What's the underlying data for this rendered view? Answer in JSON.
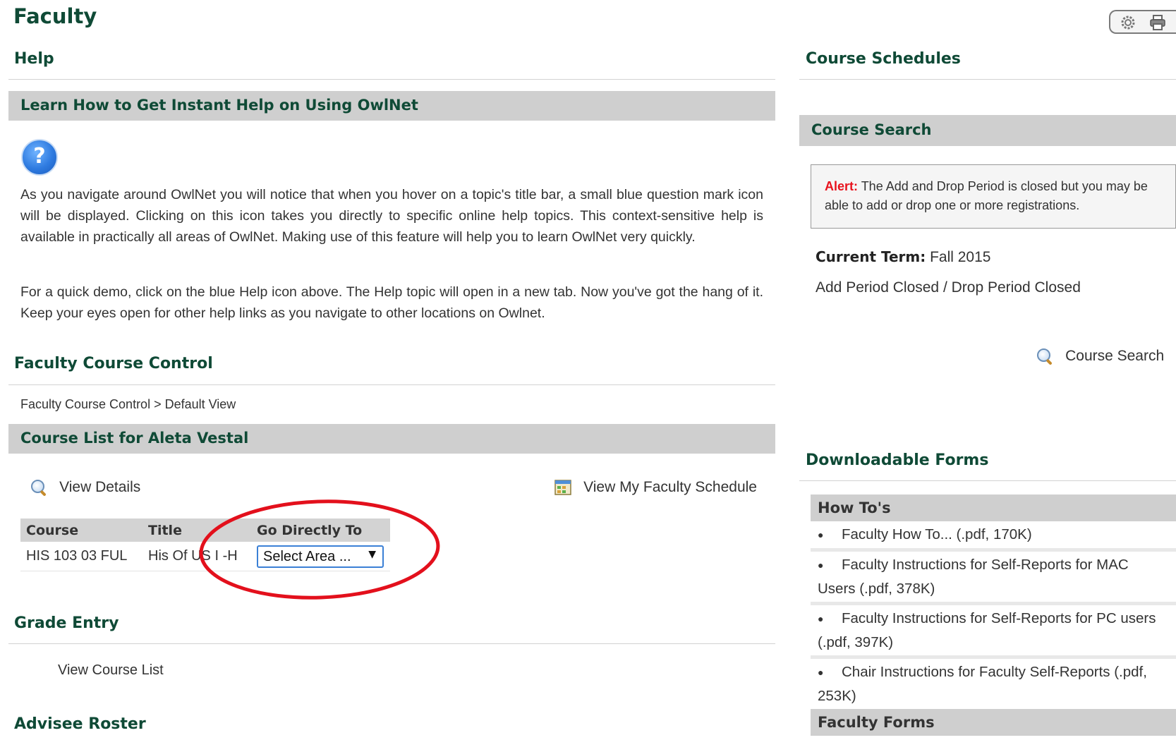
{
  "page": {
    "title": "Faculty"
  },
  "toolbar": {
    "settings_icon": "gear-icon",
    "print_icon": "printer-icon"
  },
  "help": {
    "section_title": "Help",
    "bar_title": "Learn How to Get Instant Help on Using OwlNet",
    "icon": "help-question-icon",
    "icon_glyph": "?",
    "paragraph1": "As you navigate around OwlNet you will notice that when you hover on a topic's title bar, a small blue question mark icon will be displayed. Clicking on this icon takes you directly to specific online help topics. This context-sensitive help is available in practically all areas of OwlNet. Making use of this feature will help you to learn OwlNet very quickly.",
    "paragraph2": "For a quick demo, click on the blue Help icon above. The Help topic will open in a new tab. Now you've got the hang of it. Keep your eyes open for other help links as you navigate to other locations on Owlnet."
  },
  "fcc": {
    "section_title": "Faculty Course Control",
    "breadcrumb": "Faculty Course Control > Default View",
    "course_list_title": "Course List for Aleta Vestal",
    "view_details": "View Details",
    "view_schedule": "View My Faculty Schedule",
    "table": {
      "headers": [
        "Course",
        "Title",
        "Go Directly To"
      ],
      "rows": [
        {
          "course": "HIS 103 03 FUL",
          "title": "His Of US I -H",
          "select_value": "Select Area ...",
          "select_arrow": "▼"
        }
      ]
    }
  },
  "grade": {
    "section_title": "Grade Entry",
    "link": "View Course List"
  },
  "advisee": {
    "section_title": "Advisee Roster"
  },
  "schedules": {
    "section_title": "Course Schedules",
    "search_bar_title": "Course Search",
    "alert_label": "Alert:",
    "alert_text": " The Add and Drop Period is closed but you may be able to add or drop one or more registrations.",
    "current_term_label": "Current Term:",
    "current_term_value": " Fall 2015",
    "period_status": "Add Period Closed / Drop Period Closed",
    "search_link": "Course Search"
  },
  "forms": {
    "section_title": "Downloadable Forms",
    "howtos_title": "How To's",
    "bullet": "●",
    "items": [
      "Faculty How To... (.pdf, 170K)",
      "Faculty Instructions for Self-Reports for MAC Users (.pdf, 378K)",
      "Faculty Instructions for Self-Reports for PC users (.pdf, 397K)",
      "Chair Instructions for Faculty Self-Reports (.pdf, 253K)"
    ],
    "faculty_forms_title": "Faculty Forms"
  },
  "colors": {
    "header_green": "#0f4a36",
    "alert_red": "#e8121d",
    "bar_gray": "#cfcfcf",
    "annotation_red": "#e3101c"
  }
}
